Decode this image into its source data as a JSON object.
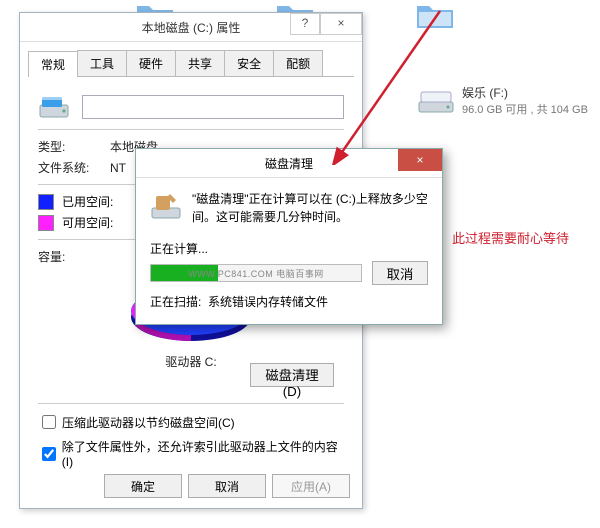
{
  "prop_window": {
    "title": "本地磁盘 (C:) 属性",
    "help": "?",
    "close": "×",
    "tabs": [
      "常规",
      "工具",
      "硬件",
      "共享",
      "安全",
      "配额"
    ],
    "type_label": "类型:",
    "type_value": "本地磁盘",
    "fs_label": "文件系统:",
    "fs_value": "NT",
    "used_label": "已用空间:",
    "free_label": "可用空间:",
    "capacity_label": "容量:",
    "drive_letter": "驱动器 C:",
    "cleanup_btn": "磁盘清理(D)",
    "chk1": "压缩此驱动器以节约磁盘空间(C)",
    "chk2": "除了文件属性外，还允许索引此驱动器上文件的内容(I)",
    "ok": "确定",
    "cancel": "取消",
    "apply": "应用(A)"
  },
  "cleanup": {
    "title": "磁盘清理",
    "close": "×",
    "msg": "\"磁盘清理\"正在计算可以在 (C:)上释放多少空间。这可能需要几分钟时间。",
    "calc_label": "正在计算...",
    "watermark": "WWW.PC841.COM 电脑百事网",
    "cancel": "取消",
    "scan_label": "正在扫描:",
    "scan_value": "系统错误内存转储文件"
  },
  "drive_item": {
    "name": "娱乐 (F:)",
    "detail": "96.0 GB 可用 , 共 104 GB"
  },
  "annotation": "此过程需要耐心等待"
}
